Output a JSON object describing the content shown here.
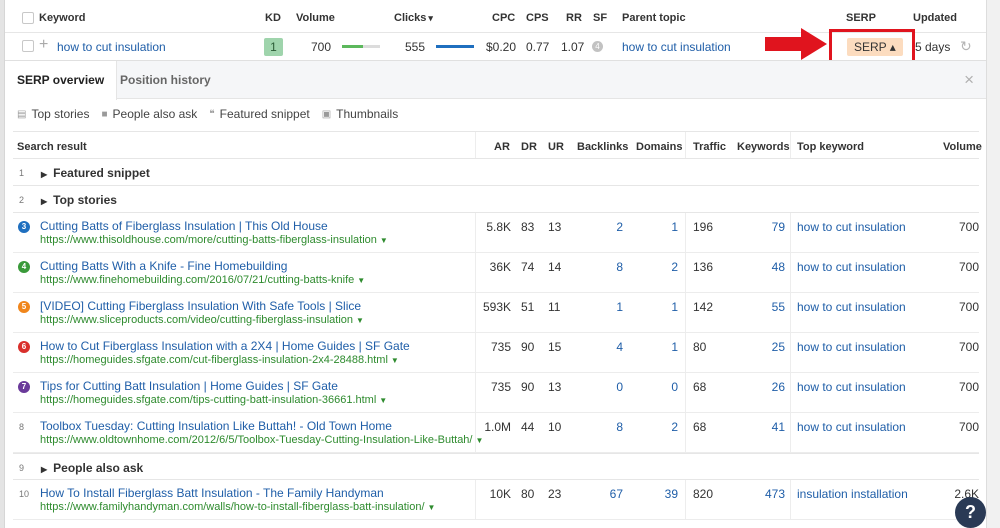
{
  "keyword_table": {
    "headers": {
      "keyword": "Keyword",
      "kd": "KD",
      "volume": "Volume",
      "clicks": "Clicks",
      "clicks_sort": "▾",
      "cpc": "CPC",
      "cps": "CPS",
      "rr": "RR",
      "sf": "SF",
      "parent_topic": "Parent topic",
      "serp": "SERP",
      "updated": "Updated"
    },
    "row": {
      "keyword": "how to cut insulation",
      "kd": "1",
      "volume": "700",
      "volume_bar_fraction": 0.55,
      "clicks": "555",
      "clicks_bar_fraction": 1.0,
      "cpc": "$0.20",
      "cps": "0.77",
      "rr": "1.07",
      "sf": "4",
      "parent_topic": "how to cut insulation",
      "serp_button": "SERP ▴",
      "updated": "5 days"
    },
    "colors": {
      "kd_badge": "#9fd4ac",
      "volume_bar": "#5cb85c",
      "clicks_bar": "#1f6fbf",
      "serp_button": "#fcdcbf",
      "annotation_red": "#e0141e"
    }
  },
  "panel": {
    "tabs": [
      {
        "label": "SERP overview",
        "active": true
      },
      {
        "label": "Position history",
        "active": false
      }
    ],
    "close_icon": "×",
    "legend": [
      {
        "icon": "top-stories-icon",
        "label": "Top stories"
      },
      {
        "icon": "people-also-ask-icon",
        "label": "People also ask"
      },
      {
        "icon": "featured-snippet-icon",
        "label": "Featured snippet"
      },
      {
        "icon": "thumbnails-icon",
        "label": "Thumbnails"
      }
    ],
    "columns": {
      "search_result": "Search result",
      "ar": "AR",
      "dr": "DR",
      "ur": "UR",
      "backlinks": "Backlinks",
      "domains": "Domains",
      "traffic": "Traffic",
      "keywords": "Keywords",
      "top_keyword": "Top keyword",
      "volume": "Volume"
    },
    "sections": {
      "s1": {
        "pos": "1",
        "title": "Featured snippet"
      },
      "s2": {
        "pos": "2",
        "title": "Top stories"
      },
      "s9": {
        "pos": "9",
        "title": "People also ask"
      }
    },
    "results": [
      {
        "pos": "3",
        "badge_color": "#1f6fbf",
        "title": "Cutting Batts of Fiberglass Insulation | This Old House",
        "url": "https://www.thisoldhouse.com/more/cutting-batts-fiberglass-insulation",
        "ar": "5.8K",
        "dr": "83",
        "ur": "13",
        "backlinks": "2",
        "domains": "1",
        "traffic": "196",
        "keywords": "79",
        "top_keyword": "how to cut insulation",
        "volume": "700"
      },
      {
        "pos": "4",
        "badge_color": "#3a9a3a",
        "title": "Cutting Batts With a Knife - Fine Homebuilding",
        "url": "https://www.finehomebuilding.com/2016/07/21/cutting-batts-knife",
        "ar": "36K",
        "dr": "74",
        "ur": "14",
        "backlinks": "8",
        "domains": "2",
        "traffic": "136",
        "keywords": "48",
        "top_keyword": "how to cut insulation",
        "volume": "700"
      },
      {
        "pos": "5",
        "badge_color": "#f0861c",
        "title": "[VIDEO] Cutting Fiberglass Insulation With Safe Tools | Slice",
        "url": "https://www.sliceproducts.com/video/cutting-fiberglass-insulation",
        "ar": "593K",
        "dr": "51",
        "ur": "11",
        "backlinks": "1",
        "domains": "1",
        "traffic": "142",
        "keywords": "55",
        "top_keyword": "how to cut insulation",
        "volume": "700"
      },
      {
        "pos": "6",
        "badge_color": "#d9302c",
        "title": "How to Cut Fiberglass Insulation with a 2X4 | Home Guides | SF Gate",
        "url": "https://homeguides.sfgate.com/cut-fiberglass-insulation-2x4-28488.html",
        "ar": "735",
        "dr": "90",
        "ur": "15",
        "backlinks": "4",
        "domains": "1",
        "traffic": "80",
        "keywords": "25",
        "top_keyword": "how to cut insulation",
        "volume": "700"
      },
      {
        "pos": "7",
        "badge_color": "#6a3a9a",
        "title": "Tips for Cutting Batt Insulation | Home Guides | SF Gate",
        "url": "https://homeguides.sfgate.com/tips-cutting-batt-insulation-36661.html",
        "ar": "735",
        "dr": "90",
        "ur": "13",
        "backlinks": "0",
        "domains": "0",
        "traffic": "68",
        "keywords": "26",
        "top_keyword": "how to cut insulation",
        "volume": "700"
      },
      {
        "pos": "8",
        "badge_color": "",
        "title": "Toolbox Tuesday: Cutting Insulation Like Buttah! - Old Town Home",
        "url": "https://www.oldtownhome.com/2012/6/5/Toolbox-Tuesday-Cutting-Insulation-Like-Buttah/",
        "ar": "1.0M",
        "dr": "44",
        "ur": "10",
        "backlinks": "8",
        "domains": "2",
        "traffic": "68",
        "keywords": "41",
        "top_keyword": "how to cut insulation",
        "volume": "700"
      },
      {
        "pos": "10",
        "badge_color": "",
        "title": "How To Install Fiberglass Batt Insulation - The Family Handyman",
        "url": "https://www.familyhandyman.com/walls/how-to-install-fiberglass-batt-insulation/",
        "ar": "10K",
        "dr": "80",
        "ur": "23",
        "backlinks": "67",
        "domains": "39",
        "traffic": "820",
        "keywords": "473",
        "top_keyword": "insulation installation",
        "volume": "2.6K"
      }
    ]
  },
  "help_button": "?"
}
